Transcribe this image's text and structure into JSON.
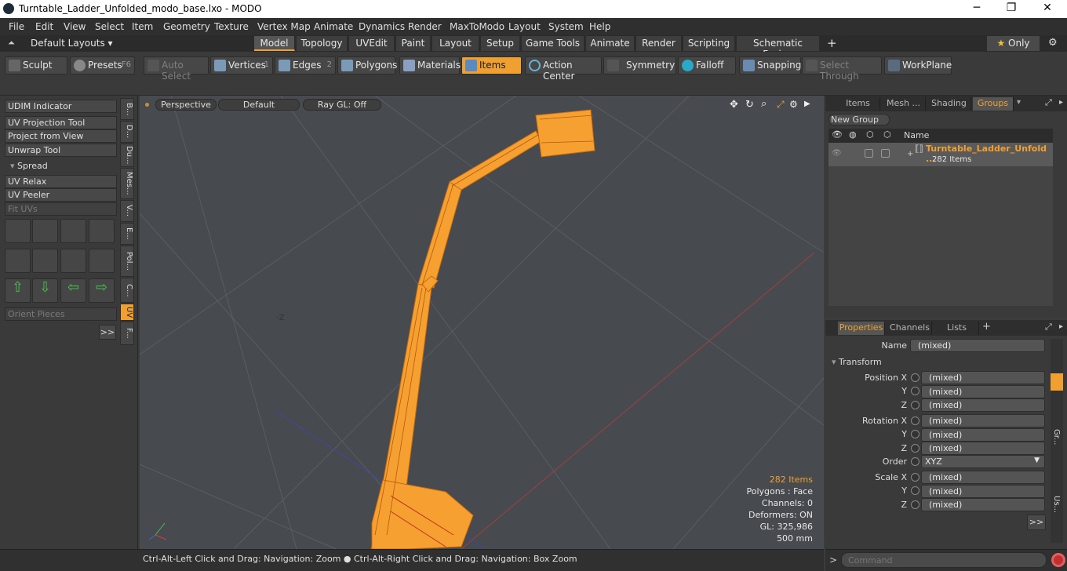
{
  "window": {
    "title": "Turntable_Ladder_Unfolded_modo_base.lxo - MODO"
  },
  "menubar": [
    "File",
    "Edit",
    "View",
    "Select",
    "Item",
    "Geometry",
    "Texture",
    "Vertex Map",
    "Animate",
    "Dynamics",
    "Render",
    "MaxToModo",
    "Layout",
    "System",
    "Help"
  ],
  "layout": {
    "selector": "Default Layouts",
    "tabs": [
      "Model",
      "Topology",
      "UVEdit",
      "Paint",
      "Layout",
      "Setup",
      "Game Tools",
      "Animate",
      "Render",
      "Scripting",
      "Schematic Fusion"
    ],
    "active_tab": "Model",
    "only_label": "Only"
  },
  "toolbar": {
    "sculpt": "Sculpt",
    "presets": "Presets",
    "presets_key": "F6",
    "auto_select": "Auto Select",
    "vertices": "Vertices",
    "vertices_key": "1",
    "edges": "Edges",
    "edges_key": "2",
    "polygons": "Polygons",
    "materials": "Materials",
    "items": "Items",
    "action_center": "Action Center",
    "symmetry": "Symmetry",
    "falloff": "Falloff",
    "snapping": "Snapping",
    "select_through": "Select Through",
    "workplane": "WorkPlane"
  },
  "leftpanel": {
    "buttons": [
      "UDIM Indicator",
      "UV Projection Tool",
      "Project from View",
      "Unwrap Tool"
    ],
    "spread": "Spread",
    "buttons2": [
      "UV Relax",
      "UV Peeler"
    ],
    "fit_uvs": "Fit UVs",
    "orient_pieces": "Orient Pieces",
    "more": ">>",
    "vtabs": [
      "B...",
      "D...",
      "Du...",
      "Mes...",
      "V...",
      "E...",
      "Pol...",
      "C...",
      "UV",
      "F..."
    ]
  },
  "viewport": {
    "view": "Perspective",
    "shading": "Default",
    "raygl": "Ray GL: Off",
    "axis_label": "-Z",
    "stats": {
      "items": "282 Items",
      "polygons": "Polygons : Face",
      "channels": "Channels: 0",
      "deformers": "Deformers: ON",
      "gl": "GL: 325,986",
      "scale": "500 mm"
    }
  },
  "statusbar": "Ctrl-Alt-Left Click and Drag: Navigation: Zoom ● Ctrl-Alt-Right Click and Drag: Navigation: Box Zoom",
  "groups_panel": {
    "tabs": [
      "Items",
      "Mesh ...",
      "Shading",
      "Groups"
    ],
    "active_tab": "Groups",
    "new_group": "New Group",
    "col_name": "Name",
    "group_name": "Turntable_Ladder_Unfold ...",
    "group_count": "282 Items"
  },
  "properties_panel": {
    "tabs": [
      "Properties",
      "Channels",
      "Lists"
    ],
    "active_tab": "Properties",
    "name_label": "Name",
    "name_value": "(mixed)",
    "transform": "Transform",
    "position_x": "Position X",
    "rotation_x": "Rotation X",
    "scale_x": "Scale X",
    "y": "Y",
    "z": "Z",
    "mixed": "(mixed)",
    "order_label": "Order",
    "order_value": "XYZ",
    "more": ">>",
    "side_tabs": [
      "Gr...",
      "Us..."
    ]
  },
  "command": {
    "placeholder": "Command"
  },
  "colors": {
    "accent": "#f0a030",
    "model": "#f5a030"
  }
}
